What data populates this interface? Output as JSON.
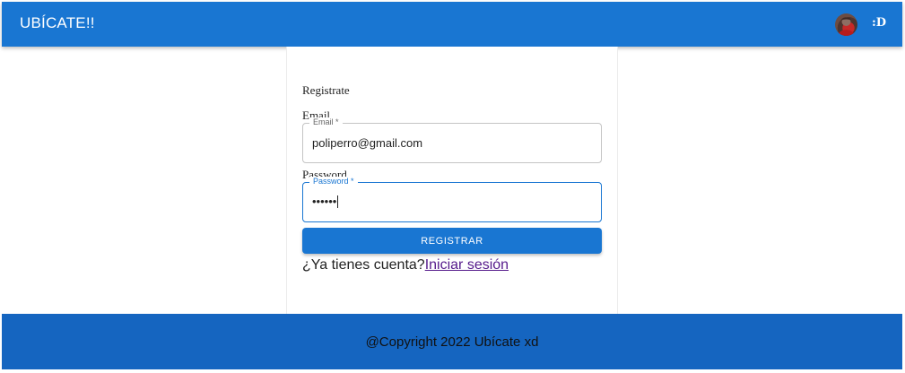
{
  "appbar": {
    "brand": "UBÍCATE!!",
    "smiley": ":D",
    "avatar_icon": "user-avatar-icon"
  },
  "form": {
    "title": "Registrate",
    "email": {
      "label": "Email",
      "legend": "Email *",
      "value": "poliperro@gmail.com"
    },
    "password": {
      "label": "Password",
      "legend": "Password *",
      "value": "••••••"
    },
    "submit_label": "REGISTRAR",
    "account_question": "¿Ya tienes cuenta?",
    "login_link": "Iniciar sesión"
  },
  "footer": {
    "text": "@Copyright 2022 Ubícate xd"
  },
  "colors": {
    "primary": "#1976d2",
    "footer": "#1565c0",
    "link_visited": "#551a8b"
  }
}
